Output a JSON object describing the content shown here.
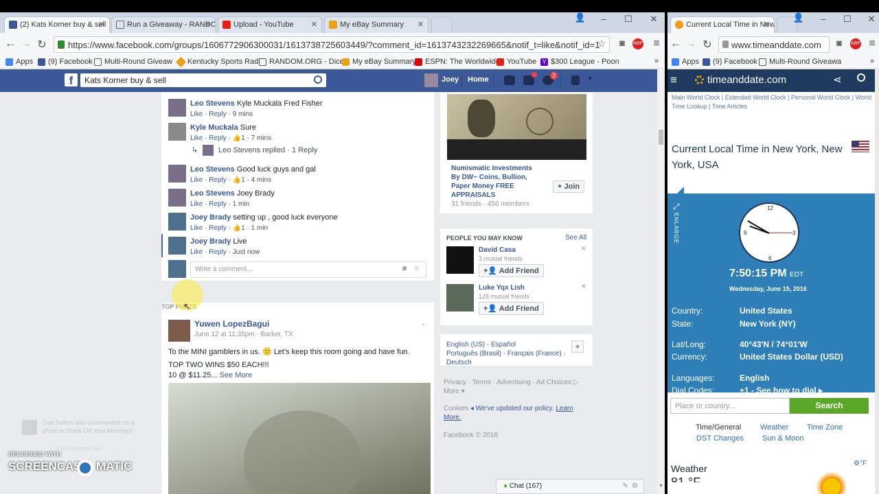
{
  "left_window": {
    "tabs": [
      {
        "label": "(2) Kats Korner buy & sell",
        "color": "#3b5998"
      },
      {
        "label": "Run a Giveaway - RANDOM",
        "color": "#666666"
      },
      {
        "label": "Upload - YouTube",
        "color": "#e62117"
      },
      {
        "label": "My eBay Summary",
        "color": "#e8a317"
      }
    ],
    "url": "https://www.facebook.com/groups/1606772906300031/1613738725603449/?comment_id=1613743232269665&notif_t=like&notif_id=1",
    "bookmarks": [
      "Apps",
      "(9) Facebook",
      "Multi-Round Giveaw",
      "Kentucky Sports Radi",
      "RANDOM.ORG - Dice",
      "My eBay Summary",
      "ESPN: The Worldwide",
      "YouTube",
      "$300 League - Poon"
    ],
    "bookmark_overflow": "»"
  },
  "facebook": {
    "search_value": "Kats Korner buy & sell",
    "user_name": "Joey",
    "home_label": "Home",
    "badges": {
      "messages": "",
      "notifications": "2"
    },
    "comments": [
      {
        "name": "Leo Stevens",
        "text": "Kyle Muckala Fred Fisher",
        "like": "Like",
        "reply": "Reply",
        "likes": "",
        "time": "9 mins"
      },
      {
        "name": "Kyle Muckala",
        "text": "Sure",
        "like": "Like",
        "reply": "Reply",
        "likes": "1",
        "time": "7 mins"
      },
      {
        "name": "Leo Stevens",
        "text": "Good luck guys and gal",
        "like": "Like",
        "reply": "Reply",
        "likes": "1",
        "time": "4 mins"
      },
      {
        "name": "Leo Stevens",
        "text": "Joey Brady",
        "like": "Like",
        "reply": "Reply",
        "likes": "",
        "time": "1 min"
      },
      {
        "name": "Joey Brady",
        "text": "setting up , good luck everyone",
        "like": "Like",
        "reply": "Reply",
        "likes": "1",
        "time": "1 min"
      },
      {
        "name": "Joey Brady",
        "text": "Live",
        "like": "Like",
        "reply": "Reply",
        "likes": "",
        "time": "Just now"
      }
    ],
    "reply_summary": {
      "name": "Leo Stevens",
      "action": "replied",
      "count": "1 Reply"
    },
    "comment_placeholder": "Write a comment...",
    "top_posts_label": "TOP POSTS",
    "post": {
      "author": "Yuwen LopezBagui",
      "date": "June 12 at 11:35pm",
      "location": "Barker, TX",
      "line1": "To the MINI gamblers in us. 🙂 Let's keep this room going and have fun.",
      "line2": "TOP TWO WINS $50 EACH!!!",
      "line3": "10 @ $11.25...",
      "see_more": "See More"
    },
    "ghost_notification": {
      "text": "Dan Sutton also commented on a photo in Show Off Your Monday!!",
      "time": "a few seconds ago"
    },
    "group_card": {
      "title": "Numismatic Investments By DW~ Coins, Bullion, Paper Money FREE APPRAISALS",
      "stats": "31 friends · 456 members",
      "join": "Join"
    },
    "pymk": {
      "header": "PEOPLE YOU MAY KNOW",
      "see_all": "See All",
      "people": [
        {
          "name": "David Casa",
          "mutual": "3 mutual friends",
          "action": "Add Friend"
        },
        {
          "name": "Luke Yqx Lish",
          "mutual": "128 mutual friends",
          "action": "Add Friend"
        }
      ]
    },
    "languages": {
      "line1": "English (US) · Español",
      "line2": "Português (Brasil) · Français (France) ·",
      "line3": "Deutsch"
    },
    "footer": {
      "links": "Privacy · Terms · Advertising · Ad Choices",
      "more": "More",
      "cookies_label": "Cookies",
      "cookies_text": "We've updated our policy.",
      "learn_more": "Learn More.",
      "copyright": "Facebook © 2016"
    },
    "chat": "Chat (167)"
  },
  "watermark": {
    "line1": "RECORDED WITH",
    "line2": "SCREENCAST",
    "line3": "MATIC"
  },
  "right_window": {
    "tab_label": "Current Local Time in New",
    "url": "www.timeanddate.com",
    "bookmarks": [
      "Apps",
      "(9) Facebook",
      "Multi-Round Giveawa"
    ],
    "site_title": "timeanddate.com",
    "nav_links": "Main World Clock | Extended World Clock | Personal World Clock | World Time Lookup | Time Articles",
    "heading": "Current Local Time in New York, New York, USA",
    "enlarge": "ENLARGE",
    "time": "7:50:15 PM",
    "tz": "EDT",
    "date": "Wednesday, June 15, 2016",
    "rows": [
      {
        "k": "Country:",
        "v": "United States"
      },
      {
        "k": "State:",
        "v": "New York (NY)"
      },
      {
        "k": "Lat/Long:",
        "v": "40°43'N / 74°01'W"
      },
      {
        "k": "Currency:",
        "v": "United States Dollar (USD)"
      },
      {
        "k": "Languages:",
        "v": "English"
      },
      {
        "k": "Dial Codes:",
        "v": "+1 - See how to dial ▸"
      }
    ],
    "search_placeholder": "Place or country...",
    "search_button": "Search",
    "links": [
      "Time/General",
      "Weather",
      "Time Zone",
      "DST Changes",
      "Sun & Moon"
    ],
    "weather_label": "Weather",
    "weather_value": "81 °F",
    "unit_toggle": "°F"
  },
  "colors": {
    "fb_blue": "#3b5998",
    "tad_blue": "#2e7fb8",
    "search_green": "#5ba829"
  }
}
